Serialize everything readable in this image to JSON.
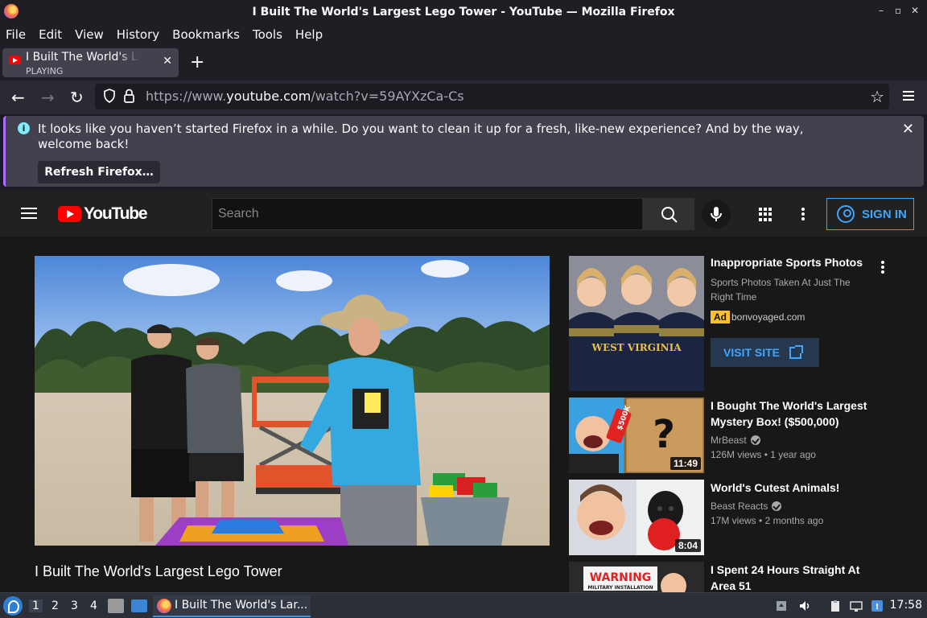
{
  "window": {
    "title": "I Built The World's Largest Lego Tower - YouTube — Mozilla Firefox",
    "controls": [
      "–",
      "▫",
      "✕"
    ]
  },
  "menubar": {
    "items": [
      "File",
      "Edit",
      "View",
      "History",
      "Bookmarks",
      "Tools",
      "Help"
    ]
  },
  "tabs": [
    {
      "title": "I Built The World's Largest Lego Tower - YouTube",
      "subtitle": "PLAYING"
    }
  ],
  "navbar": {
    "url_prefix": "https://www.",
    "url_domain": "youtube.com",
    "url_path": "/watch?v=59AYXzCa-Cs"
  },
  "notification": {
    "message": "It looks like you haven’t started Firefox in a while. Do you want to clean it up for a fresh, like-new experience? And by the way, welcome back!",
    "button": "Refresh Firefox…"
  },
  "youtube": {
    "logo_text": "YouTube",
    "search_placeholder": "Search",
    "sign_in": "SIGN IN",
    "video_title": "I Built The World's Largest Lego Tower",
    "ad": {
      "title": "Inappropriate Sports Photos",
      "description": "Sports Photos Taken At Just The Right Time",
      "badge": "Ad",
      "domain": "bonvoyaged.com",
      "cta": "VISIT SITE",
      "thumb_text": "WEST VIRGINIA"
    },
    "recommendations": [
      {
        "title": "I Bought The World's Largest Mystery Box! ($500,000)",
        "channel": "MrBeast",
        "views": "126M views",
        "age": "1 year ago",
        "duration": "11:49",
        "thumb_text": "$500K"
      },
      {
        "title": "World's Cutest Animals!",
        "channel": "Beast Reacts",
        "views": "17M views",
        "age": "2 months ago",
        "duration": "8:04"
      },
      {
        "title": "I Spent 24 Hours Straight At Area 51",
        "thumb_text": "WARNING",
        "thumb_subtext": "MILITARY INSTALLATION"
      }
    ]
  },
  "taskbar": {
    "workspaces": [
      "1",
      "2",
      "3",
      "4"
    ],
    "active_window": "I Built The World's Lar...",
    "clock": "17:58"
  },
  "colors": {
    "firefox_dark": "#1c1b22",
    "youtube_red": "#ff0000",
    "youtube_blue": "#3ea6ff",
    "ad_yellow": "#fbc02d"
  }
}
